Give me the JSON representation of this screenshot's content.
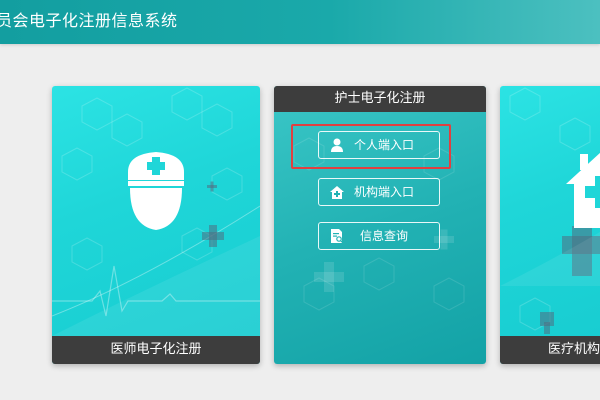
{
  "header": {
    "title": "员会电子化注册信息系统"
  },
  "cards": {
    "doctor": {
      "label": "医师电子化注册",
      "icon": "doctor-head-icon"
    },
    "nurse": {
      "title": "护士电子化注册",
      "buttons": [
        {
          "label": "个人端入口",
          "icon": "person-icon"
        },
        {
          "label": "机构端入口",
          "icon": "hospital-building-icon"
        },
        {
          "label": "信息查询",
          "icon": "document-search-icon"
        }
      ]
    },
    "org": {
      "label": "医疗机构电",
      "icon": "hospital-house-icon"
    }
  },
  "colors": {
    "header_bg": "#1aa9aa",
    "card_teal": "#1fd6d8",
    "footer_bg": "#3d3d3d",
    "highlight": "#e04040"
  }
}
